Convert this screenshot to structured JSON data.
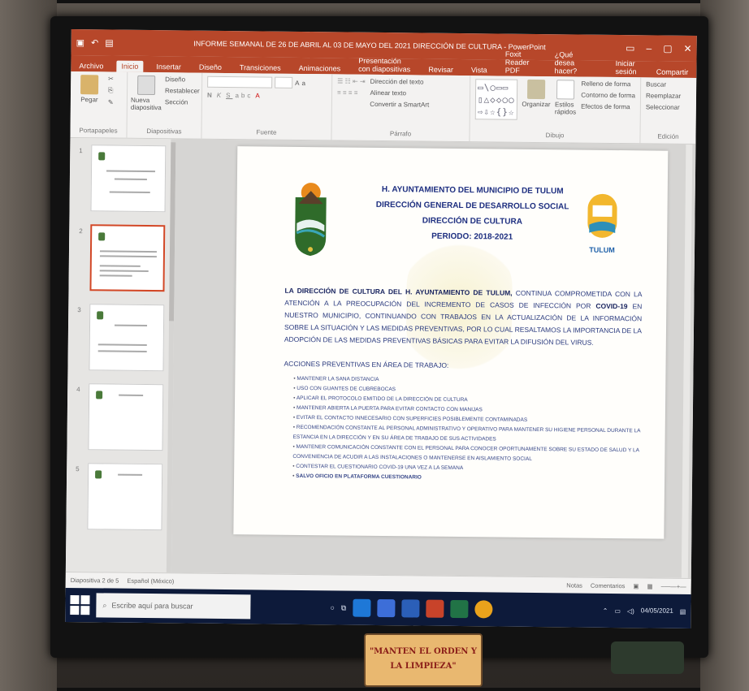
{
  "app": {
    "title": "INFORME SEMANAL DE 26 DE ABRIL AL 03 DE MAYO DEL 2021 DIRECCIÓN DE CULTURA - PowerPoint",
    "accent": "#b7472a"
  },
  "menu": {
    "tabs": [
      "Archivo",
      "Inicio",
      "Insertar",
      "Diseño",
      "Transiciones",
      "Animaciones",
      "Presentación con diapositivas",
      "Revisar",
      "Vista",
      "Foxit Reader PDF",
      "¿Qué desea hacer?"
    ],
    "active": "Inicio",
    "right": [
      "Iniciar sesión",
      "Compartir"
    ]
  },
  "ribbon": {
    "portapapeles": {
      "name": "Portapapeles",
      "paste": "Pegar"
    },
    "diapositivas": {
      "name": "Diapositivas",
      "new": "Nueva diapositiva",
      "items": [
        "Diseño",
        "Restablecer",
        "Sección"
      ]
    },
    "fuente": {
      "name": "Fuente"
    },
    "parrafo": {
      "name": "Párrafo",
      "items": [
        "Dirección del texto",
        "Alinear texto",
        "Convertir a SmartArt"
      ]
    },
    "dibujo": {
      "name": "Dibujo",
      "organize": "Organizar",
      "quick": "Estilos rápidos",
      "items": [
        "Relleno de forma",
        "Contorno de forma",
        "Efectos de forma"
      ]
    },
    "edicion": {
      "name": "Edición",
      "items": [
        "Buscar",
        "Reemplazar",
        "Seleccionar"
      ]
    }
  },
  "thumbnails": {
    "numbers": [
      "1",
      "2",
      "3",
      "4",
      "5"
    ],
    "selected": 2
  },
  "slide": {
    "header": [
      "H. AYUNTAMIENTO DEL MUNICIPIO DE TULUM",
      "DIRECCIÓN GENERAL DE DESARROLLO SOCIAL",
      "DIRECCIÓN DE CULTURA",
      "PERIODO: 2018-2021"
    ],
    "logo_text": "TULUM",
    "para_lead": "LA DIRECCIÓN DE CULTURA DEL H. AYUNTAMIENTO DE TULUM,",
    "para_body": "CONTINUA COMPROMETIDA CON LA ATENCIÓN A LA PREOCUPACIÓN DEL INCREMENTO DE CASOS DE INFECCIÓN POR",
    "para_covid": "COVID-19",
    "para_rest": "EN NUESTRO MUNICIPIO, CONTINUANDO CON TRABAJOS EN LA ACTUALIZACIÓN DE LA INFORMACIÓN SOBRE LA SITUACIÓN Y LAS MEDIDAS PREVENTIVAS, POR LO CUAL RESALTAMOS LA IMPORTANCIA DE LA ADOPCIÓN DE LAS MEDIDAS PREVENTIVAS BÁSICAS PARA EVITAR LA DIFUSIÓN DEL VIRUS.",
    "acc_title": "ACCIONES PREVENTIVAS EN ÁREA DE TRABAJO:",
    "acciones": [
      "MANTENER LA SANA DISTANCIA",
      "USO CON GUANTES DE CUBREBOCAS",
      "APLICAR EL PROTOCOLO EMITIDO DE LA DIRECCIÓN DE CULTURA",
      "MANTENER ABIERTA LA PUERTA PARA EVITAR CONTACTO CON MANIJAS",
      "EVITAR EL CONTACTO INNECESARIO CON SUPERFICIES POSIBLEMENTE CONTAMINADAS",
      "RECOMENDACIÓN CONSTANTE AL PERSONAL ADMINISTRATIVO Y OPERATIVO PARA MANTENER SU HIGIENE PERSONAL DURANTE LA ESTANCIA EN LA DIRECCIÓN Y EN SU ÁREA DE TRABAJO DE SUS ACTIVIDADES",
      "MANTENER COMUNICACIÓN CONSTANTE CON EL PERSONAL PARA CONOCER OPORTUNAMENTE SOBRE SU ESTADO DE SALUD Y LA CONVENIENCIA DE ACUDIR A LAS INSTALACIONES O MANTENERSE EN AISLAMIENTO SOCIAL",
      "CONTESTAR EL CUESTIONARIO COVID-19 UNA VEZ A LA SEMANA",
      "SALVO OFICIO EN PLATAFORMA CUESTIONARIO"
    ]
  },
  "statusbar": {
    "left": "Diapositiva 2 de 5",
    "lang": "Español (México)",
    "right": [
      "Notas",
      "Comentarios"
    ]
  },
  "taskbar": {
    "search_placeholder": "Escribe aquí para buscar",
    "time": "04/05/2021"
  },
  "sign": {
    "line1": "\"MANTEN EL ORDEN Y",
    "line2": "LA LIMPIEZA\""
  }
}
